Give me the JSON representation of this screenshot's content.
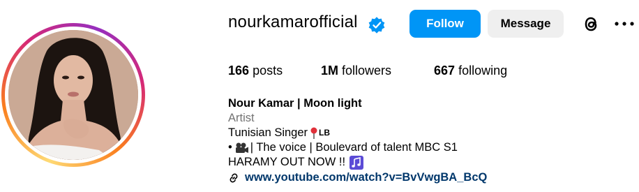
{
  "profile": {
    "username": "nourkamarofficial",
    "verified": true,
    "follow_label": "Follow",
    "message_label": "Message"
  },
  "stats": {
    "posts_count": "166",
    "posts_label": "posts",
    "followers_count": "1M",
    "followers_label": "followers",
    "following_count": "667",
    "following_label": "following"
  },
  "bio": {
    "display_name": "Nour Kamar | Moon light",
    "category": "Artist",
    "line1": "Tunisian Singer",
    "line1_badge": "LB",
    "line2_prefix": "•",
    "line2": "| The voice | Boulevard of talent MBC S1",
    "line3": "HARAMY OUT NOW !!",
    "link": "www.youtube.com/watch?v=BvVwgBA_BcQ"
  },
  "icons": {
    "verified": "verified-badge-icon",
    "threads": "threads-icon",
    "more": "more-options-icon",
    "pin": "round-pushpin-icon",
    "clapper": "movie-camera-icon",
    "music": "musical-notes-icon",
    "link": "link-icon"
  },
  "colors": {
    "accent": "#0095f6",
    "secondary_button": "#efefef",
    "link": "#00376b",
    "muted": "#737373"
  }
}
